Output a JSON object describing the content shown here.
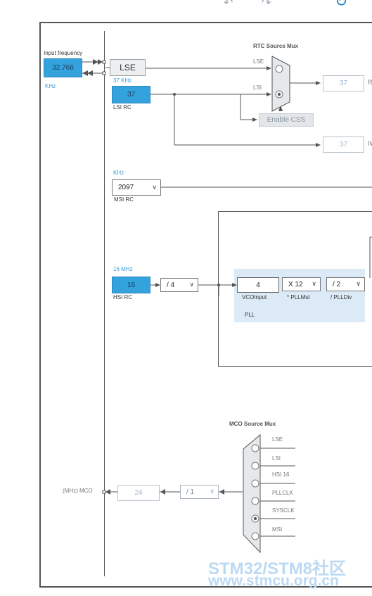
{
  "toolbar": {
    "undo_icon": "undo-icon",
    "redo_icon": "redo-icon",
    "refresh_icon": "refresh-icon"
  },
  "input_frequency": {
    "label": "Input frequency",
    "value": "32.768",
    "unit": "KHz"
  },
  "lse": {
    "label": "LSE"
  },
  "lsi": {
    "freq_label": "37 KHz",
    "value": "37",
    "name": "LSI RC"
  },
  "rtc_mux": {
    "title": "RTC Source Mux",
    "inputs": [
      "LSE",
      "LSI"
    ],
    "selected": "LSI",
    "enable_css": "Enable CSS",
    "output_value": "37",
    "output_tail": "R"
  },
  "iwdg": {
    "output_value": "37",
    "output_tail": "IW"
  },
  "msi": {
    "unit": "KHz",
    "selected": "2097",
    "name": "MSI RC"
  },
  "hsi": {
    "freq_label": "16 MHz",
    "value": "16",
    "name": "HSI RC",
    "prediv": "/ 4"
  },
  "pll": {
    "vco_input": "4",
    "vco_label": "VCOInput",
    "mul": "X 12",
    "mul_label": "* PLLMul",
    "div": "/ 2",
    "div_label": "/ PLLDiv",
    "title": "PLL"
  },
  "mco": {
    "title": "MCO Source Mux",
    "inputs": [
      "LSE",
      "LSI",
      "HSI 16",
      "PLLCLK",
      "SYSCLK",
      "MSI"
    ],
    "selected": "SYSCLK",
    "divider": "/ 1",
    "output_value": "24",
    "output_label": "(MHz) MCO"
  },
  "watermark": {
    "line1": "STM32/STM8社区",
    "line2": "www.stmcu.org.cn"
  },
  "colors": {
    "accent_blue": "#34a2dd",
    "wire": "#555555",
    "panel": "#dbeaf6"
  }
}
